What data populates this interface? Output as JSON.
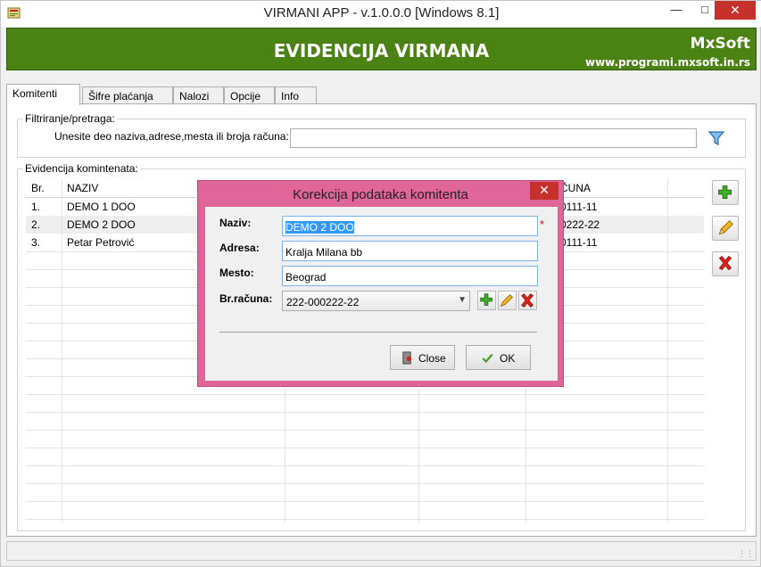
{
  "window": {
    "title": "VIRMANI APP - v.1.0.0.0  [Windows 8.1]"
  },
  "banner": {
    "title": "EVIDENCIJA VIRMANA",
    "brand": "MxSoft",
    "url": "www.programi.mxsoft.in.rs"
  },
  "tabs": [
    {
      "label": "Komitenti",
      "active": true
    },
    {
      "label": "Šifre plaćanja"
    },
    {
      "label": "Nalozi"
    },
    {
      "label": "Opcije"
    },
    {
      "label": "Info"
    }
  ],
  "filter": {
    "group_label": "Filtriranje/pretraga:",
    "prompt": "Unesite deo naziva,adrese,mesta ili broja računa:",
    "value": ""
  },
  "grid": {
    "group_label": "Evidencija komintenata:",
    "headers": {
      "br": "Br.",
      "naziv": "NAZIV",
      "racun": "ČUNA"
    },
    "rows": [
      {
        "br": "1.",
        "naziv": "DEMO 1 DOO",
        "racun": "0111-11"
      },
      {
        "br": "2.",
        "naziv": "DEMO 2 DOO",
        "racun": "0222-22"
      },
      {
        "br": "3.",
        "naziv": "Petar Petrović",
        "racun": "0111-11"
      }
    ]
  },
  "dialog": {
    "title": "Korekcija podataka komitenta",
    "fields": {
      "naziv_label": "Naziv:",
      "naziv_value": "DEMO 2 DOO",
      "adresa_label": "Adresa:",
      "adresa_value": "Kralja Milana bb",
      "mesto_label": "Mesto:",
      "mesto_value": "Beograd",
      "racun_label": "Br.računa:",
      "racun_value": "222-000222-22"
    },
    "required_mark": "*",
    "close_label": "Close",
    "ok_label": "OK"
  },
  "colors": {
    "banner": "#4a8214",
    "dialog_frame": "#e0669a",
    "close_red": "#c7312c",
    "selection": "#3399ff"
  }
}
